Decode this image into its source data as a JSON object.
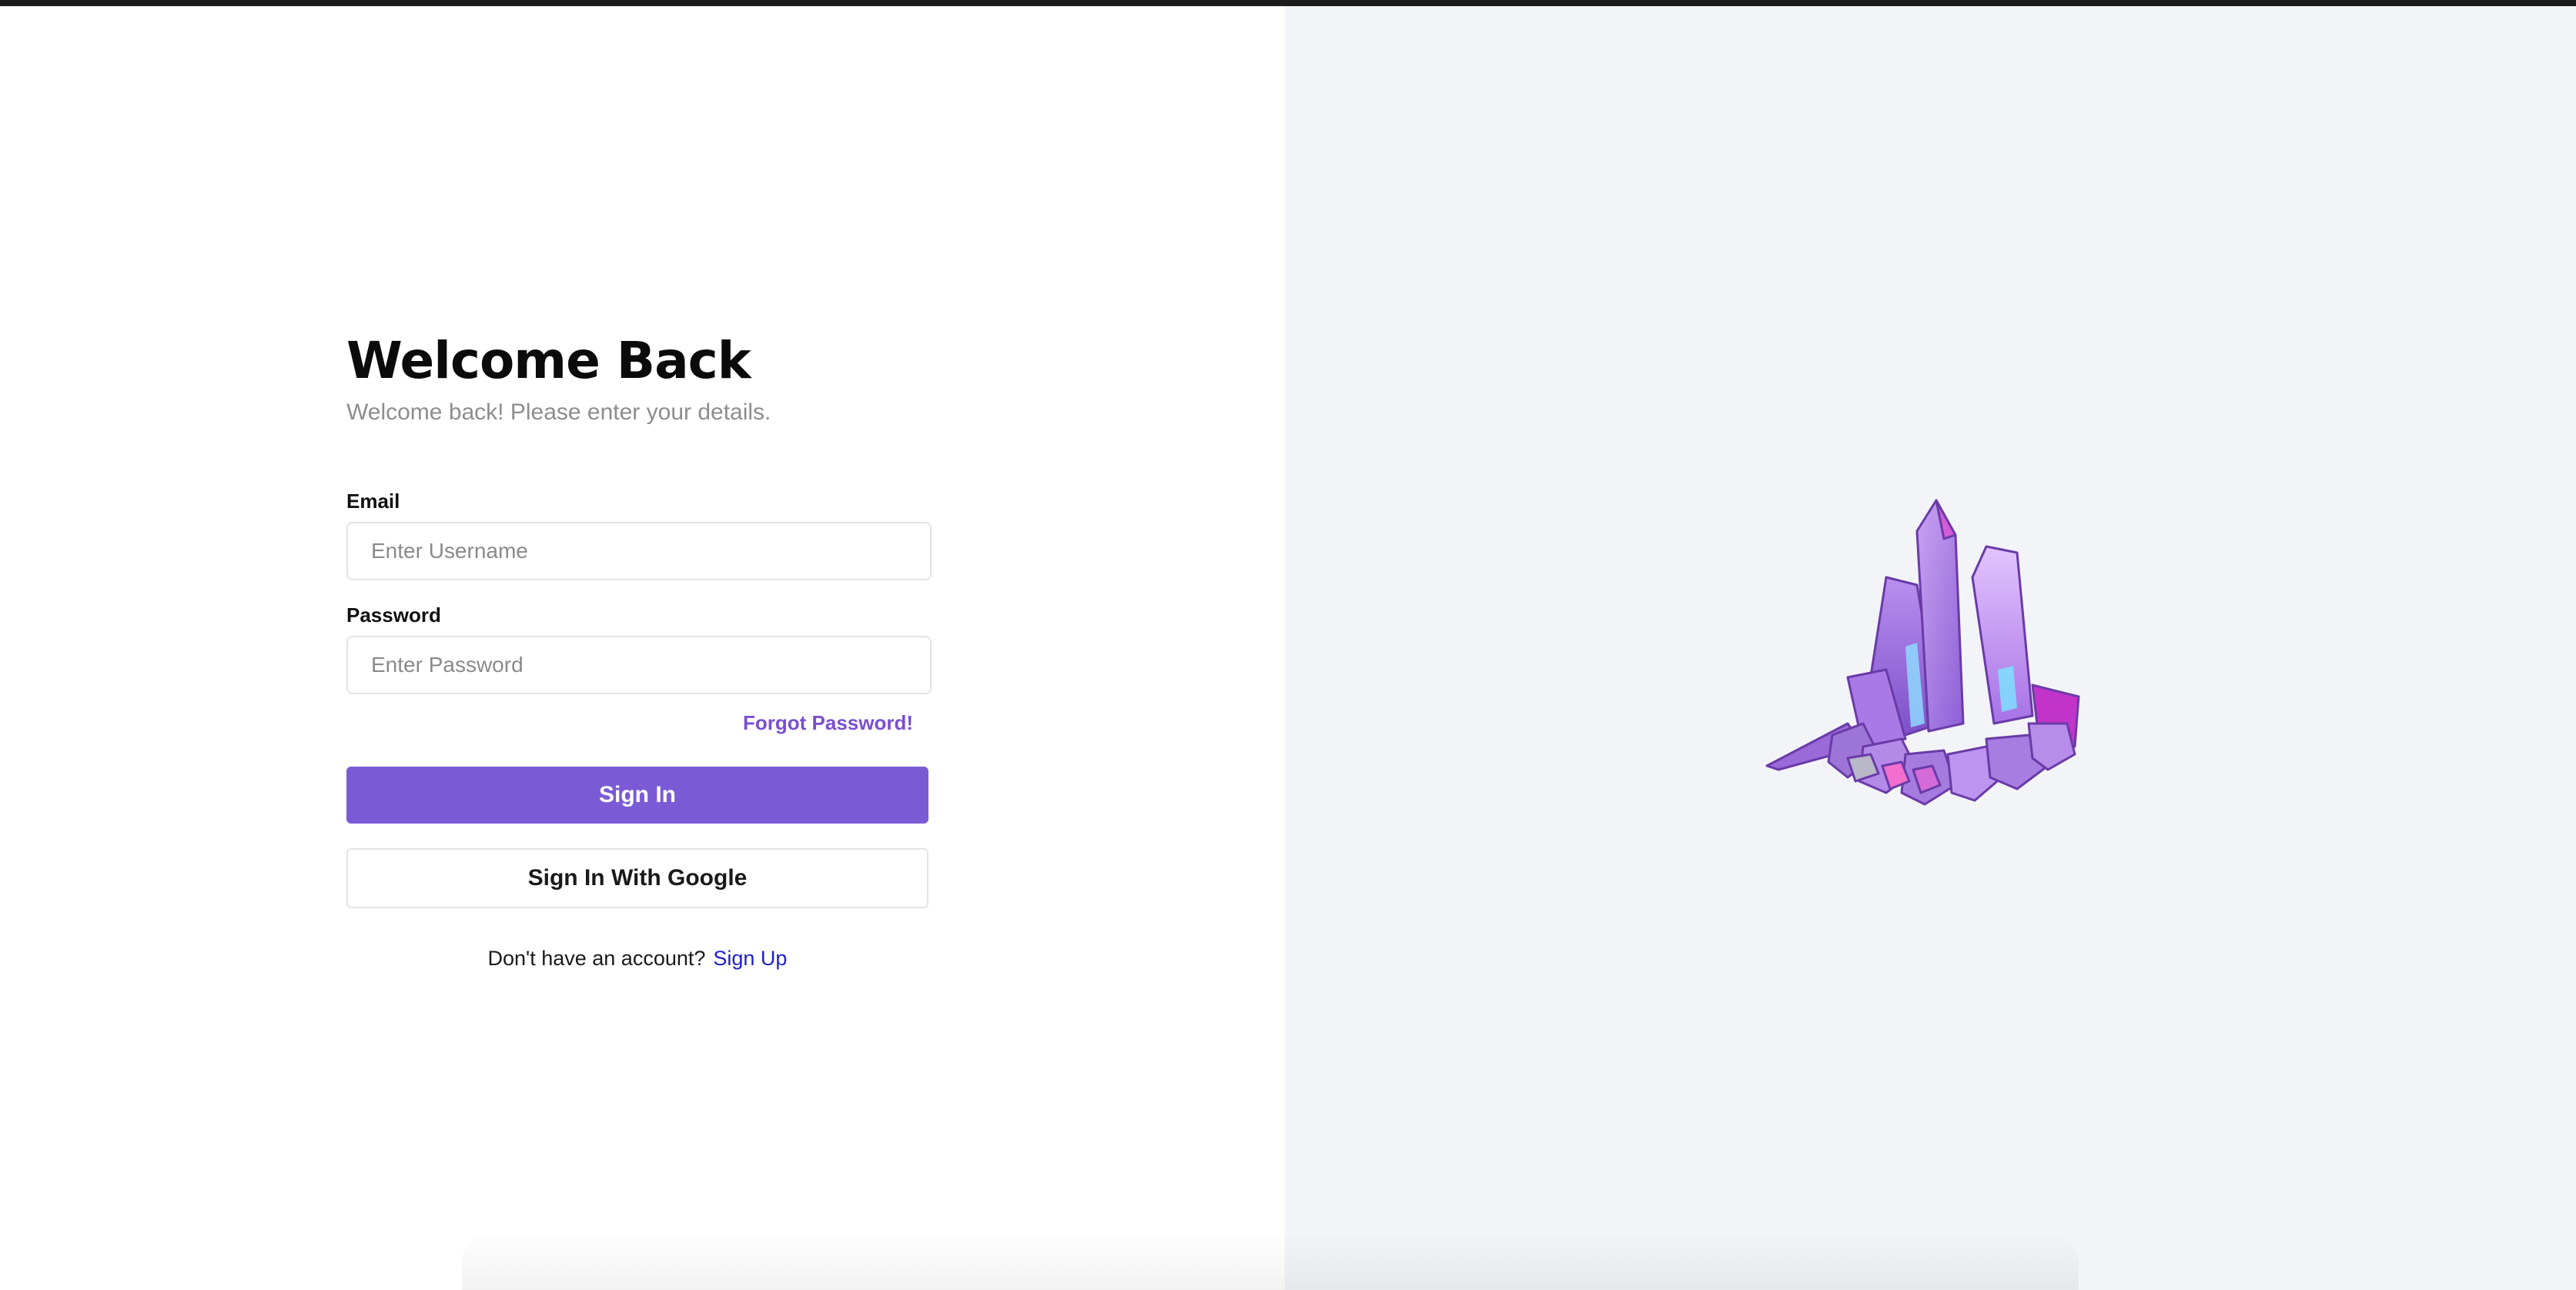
{
  "login": {
    "title": "Welcome Back",
    "subtitle": "Welcome back! Please enter your details.",
    "email_label": "Email",
    "email_placeholder": "Enter Username",
    "email_value": "",
    "password_label": "Password",
    "password_placeholder": "Enter Password",
    "password_value": "",
    "forgot_label": "Forgot Password!",
    "signin_label": "Sign In",
    "google_label": "Sign In With Google",
    "no_account_text": "Don't have an account?",
    "signup_label": "Sign Up"
  },
  "illustration": {
    "icon": "amethyst-crystal-icon"
  },
  "colors": {
    "accent": "#7b5bd5",
    "forgot_link": "#7a4fd1",
    "signup_link": "#2020c8",
    "right_pane_bg": "#f3f4f8"
  }
}
